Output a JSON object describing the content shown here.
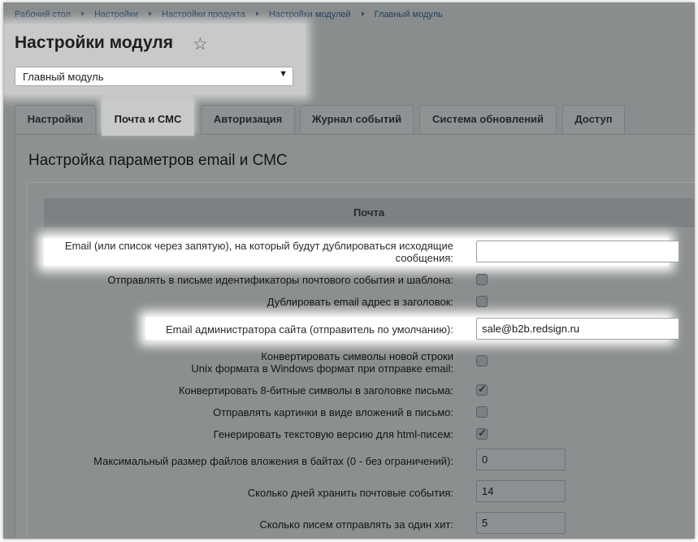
{
  "breadcrumb": [
    "Рабочий стол",
    "Настройки",
    "Настройки продукта",
    "Настройки модулей",
    "Главный модуль"
  ],
  "page": {
    "title": "Настройки модуля",
    "star_icon": "☆",
    "module_select": {
      "value": "Главный модуль",
      "arrow": "▼"
    }
  },
  "tabs": [
    {
      "label": "Настройки",
      "active": false
    },
    {
      "label": "Почта и СМС",
      "active": true
    },
    {
      "label": "Авторизация",
      "active": false
    },
    {
      "label": "Журнал событий",
      "active": false
    },
    {
      "label": "Система обновлений",
      "active": false
    },
    {
      "label": "Доступ",
      "active": false
    }
  ],
  "panel": {
    "title": "Настройка параметров email и СМС",
    "section_label": "Почта",
    "fields": {
      "dup_email": {
        "label_line1": "Email (или список через запятую), на который будут дублироваться исходящие",
        "label_line2": "сообщения:",
        "value": ""
      },
      "send_ids": {
        "label": "Отправлять в письме идентификаторы почтового события и шаблона:",
        "checked": false
      },
      "dup_header": {
        "label": "Дублировать email адрес в заголовок:",
        "checked": false
      },
      "admin_email": {
        "label": "Email администратора сайта (отправитель по умолчанию):",
        "value": "sale@b2b.redsign.ru"
      },
      "convert_newline": {
        "label_line1": "Конвертировать символы новой строки",
        "label_line2": "Unix формата в Windows формат при отправке email:",
        "checked": false
      },
      "convert_8bit": {
        "label": "Конвертировать 8-битные символы в заголовке письма:",
        "checked": true
      },
      "attach_images": {
        "label": "Отправлять картинки в виде вложений в письмо:",
        "checked": false
      },
      "text_version": {
        "label": "Генерировать текстовую версию для html-писем:",
        "checked": true
      },
      "max_attach": {
        "label": "Максимальный размер файлов вложения в байтах (0 - без ограничений):",
        "value": "0"
      },
      "keep_days": {
        "label": "Сколько дней хранить почтовые события:",
        "value": "14"
      },
      "per_hit": {
        "label": "Сколько писем отправлять за один хит:",
        "value": "5"
      }
    },
    "check_glyph": "✓"
  },
  "colors": {
    "highlight": "#ffffff",
    "dim_background": "#8a8d8e",
    "title_highlight": "#c8c9ca"
  }
}
